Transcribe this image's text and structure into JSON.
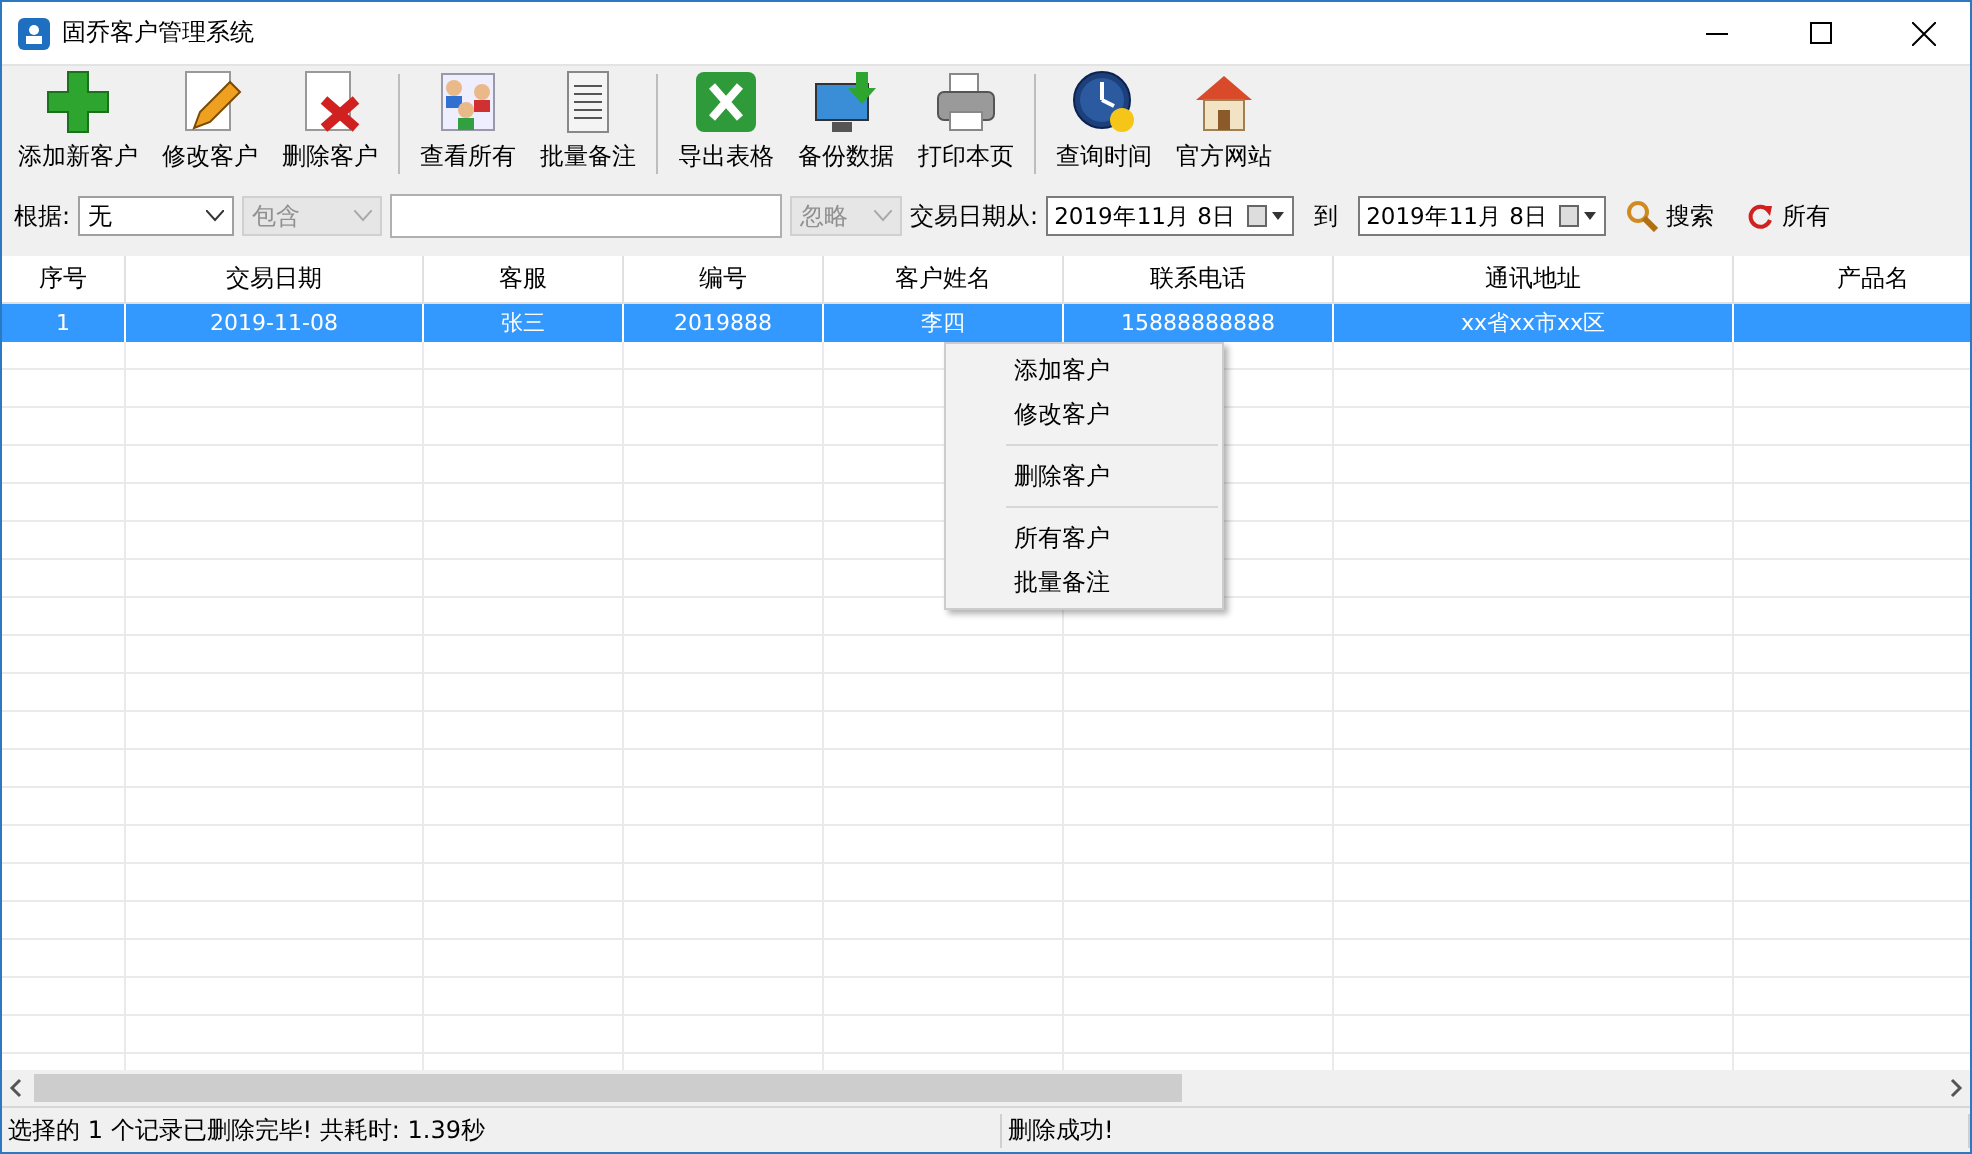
{
  "window": {
    "title": "固乔客户管理系统"
  },
  "toolbar": [
    {
      "label": "添加新客户",
      "kind": "add"
    },
    {
      "label": "修改客户",
      "kind": "edit"
    },
    {
      "label": "删除客户",
      "kind": "delete"
    },
    {
      "kind": "sep"
    },
    {
      "label": "查看所有",
      "kind": "people"
    },
    {
      "label": "批量备注",
      "kind": "scroll"
    },
    {
      "kind": "sep"
    },
    {
      "label": "导出表格",
      "kind": "excel"
    },
    {
      "label": "备份数据",
      "kind": "backup"
    },
    {
      "label": "打印本页",
      "kind": "print"
    },
    {
      "kind": "sep"
    },
    {
      "label": "查询时间",
      "kind": "clock"
    },
    {
      "label": "官方网站",
      "kind": "home"
    }
  ],
  "filter": {
    "by_label": "根据:",
    "by_value": "无",
    "match_value": "包含",
    "case_value": "忽略",
    "date_from_label": "交易日期从:",
    "date_from": "2019年11月 8日",
    "date_to_label": "到",
    "date_to": "2019年11月 8日",
    "search_button": "搜索",
    "all_button": "所有"
  },
  "table": {
    "columns": [
      "序号",
      "交易日期",
      "客服",
      "编号",
      "客户姓名",
      "联系电话",
      "通讯地址",
      "产品名"
    ],
    "rows": [
      {
        "cells": [
          "1",
          "2019-11-08",
          "张三",
          "2019888",
          "李四",
          "15888888888",
          "xx省xx市xx区",
          ""
        ],
        "selected": true
      }
    ]
  },
  "context_menu": [
    {
      "label": "添加客户",
      "kind": "item"
    },
    {
      "label": "修改客户",
      "kind": "item"
    },
    {
      "kind": "sep"
    },
    {
      "label": "删除客户",
      "kind": "item"
    },
    {
      "kind": "sep"
    },
    {
      "label": "所有客户",
      "kind": "item"
    },
    {
      "label": "批量备注",
      "kind": "item"
    }
  ],
  "status_bar": [
    "选择的 1 个记录已删除完毕! 共耗时: 1.39秒",
    "删除成功!"
  ]
}
